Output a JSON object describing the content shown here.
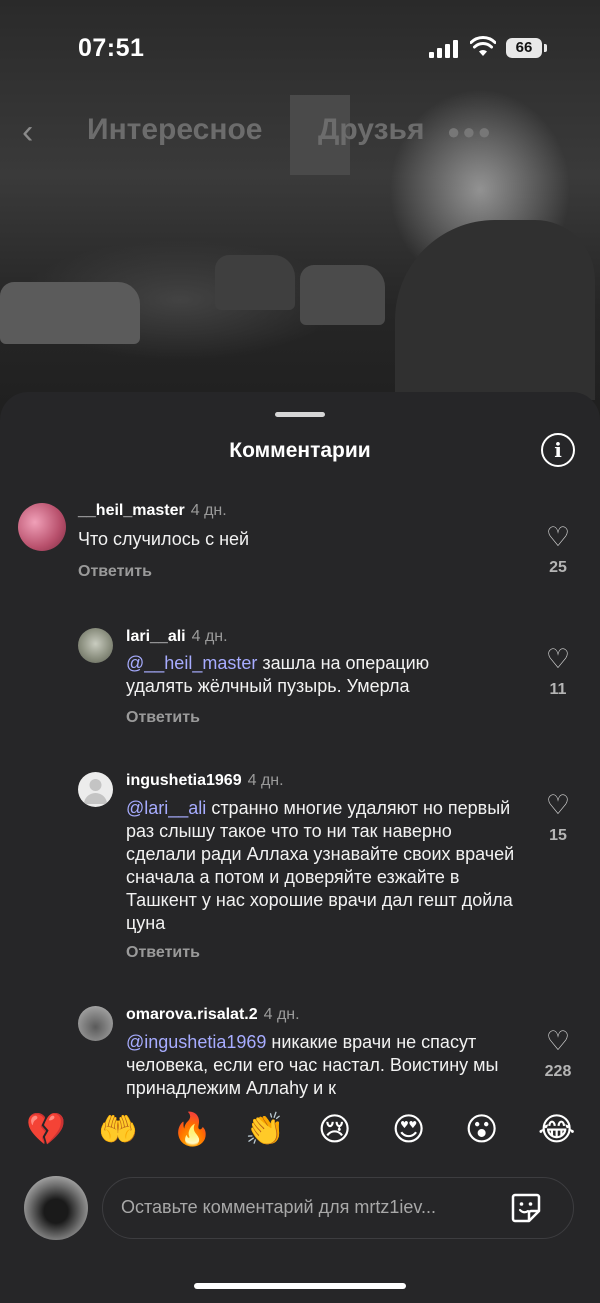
{
  "status_bar": {
    "time": "07:51",
    "battery": "66"
  },
  "top_nav": {
    "tab_explore": "Интересное",
    "tab_friends": "Друзья"
  },
  "sheet": {
    "title": "Комментарии"
  },
  "comments": [
    {
      "username": "__heil_master",
      "age": "4 дн.",
      "text": "Что случилось с ней",
      "mention": "",
      "reply": "Ответить",
      "likes": "25"
    },
    {
      "username": "lari__ali",
      "age": "4 дн.",
      "mention": "@__heil_master",
      "text": " зашла на операцию удалять жёлчный пузырь. Умерла",
      "reply": "Ответить",
      "likes": "11"
    },
    {
      "username": "ingushetia1969",
      "age": "4 дн.",
      "mention": "@lari__ali",
      "text": " странно многие удаляют но первый раз слышу такое что то ни так наверно сделали ради Аллаха узнавайте своих врачей сначала а потом и доверяйте езжайте в Ташкент у нас хорошие врачи дал гешт дойла цуна",
      "reply": "Ответить",
      "likes": "15"
    },
    {
      "username": "omarova.risalat.2",
      "age": "4 дн.",
      "mention": "@ingushetia1969",
      "text": " никакие врачи не спасут человека, если его час настал. Воистину мы принадлежим Аллаһу и к",
      "reply": "",
      "likes": "228"
    }
  ],
  "emojis": [
    "💔",
    "🤲",
    "🔥",
    "👏",
    "😢",
    "😍",
    "😮",
    "😂"
  ],
  "compose": {
    "placeholder": "Оставьте комментарий для mrtz1iev..."
  },
  "icons": [
    "back-chevron-icon",
    "info-icon",
    "heart-icon",
    "sticker-icon",
    "wifi-icon",
    "signal-icon"
  ]
}
